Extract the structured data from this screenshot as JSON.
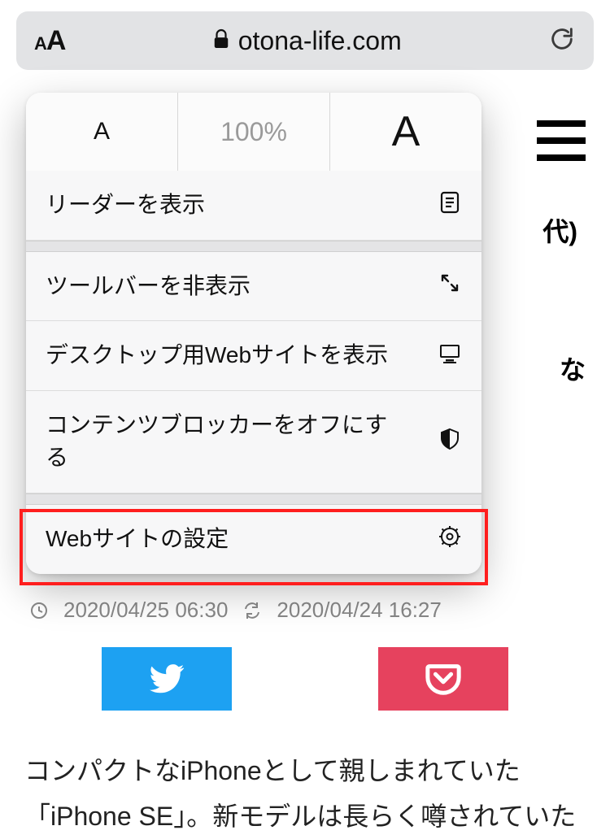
{
  "addressbar": {
    "domain": "otona-life.com"
  },
  "page": {
    "peek1": "代)",
    "peek2": "な",
    "timestamps": {
      "created": "2020/04/25 06:30",
      "updated": "2020/04/24 16:27"
    },
    "body": "コンパクトなiPhoneとして親しまれていた「iPhone SE」。新モデルは長らく噂されていた"
  },
  "menu": {
    "zoom": {
      "small": "A",
      "percent": "100%",
      "big": "A"
    },
    "items": [
      {
        "label": "リーダーを表示"
      },
      {
        "label": "ツールバーを非表示"
      },
      {
        "label": "デスクトップ用Webサイトを表示"
      },
      {
        "label": "コンテンツブロッカーをオフにする"
      },
      {
        "label": "Webサイトの設定"
      }
    ]
  }
}
